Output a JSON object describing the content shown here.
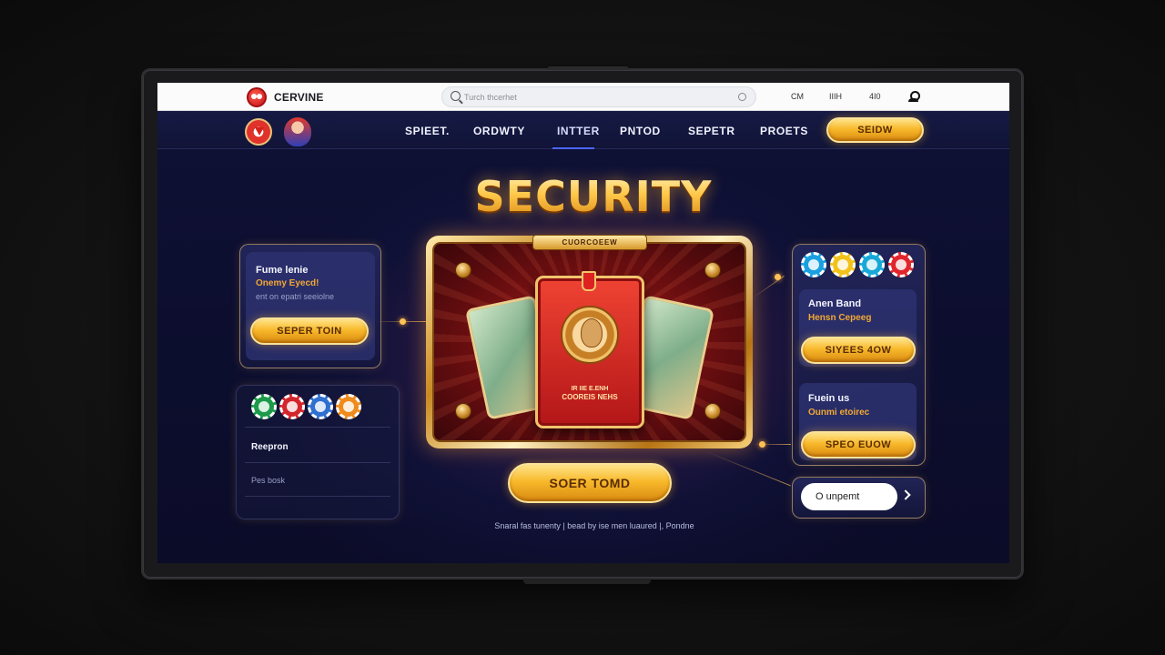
{
  "topbar": {
    "logo_text": "CERVINE",
    "search_placeholder": "Turch thcerhet",
    "items": [
      "CM",
      "IIIH",
      "4I0"
    ]
  },
  "nav": {
    "links": [
      "SPIEET.",
      "ORDWTY",
      "INTTER",
      "PNTOD",
      "SEPETR",
      "PROETS"
    ],
    "active_index": 2,
    "cta_label": "SEIDW"
  },
  "hero": {
    "title": "SECURITY",
    "plaque": "CUORCOEEW",
    "card_text_line1": "IR IIE E.ENH",
    "card_text_line2": "COOREIS NEHS",
    "cta_label": "SOER TOMD",
    "footnote": "Snaral fas tunenty | bead by ise men luaured |, Pondne"
  },
  "left_panel": {
    "title": "Fume lenie",
    "subtitle": "Onemy Eyecd!",
    "meta": "ent on epatri seeiolne",
    "button_label": "SEPER TOIN"
  },
  "left_lower_panel": {
    "chip_colors": [
      "#1c9a4a",
      "#d3262c",
      "#2f6fd0",
      "#ef8b1c"
    ],
    "row1": "Reepron",
    "row2": "Pes bosk"
  },
  "right_panel": {
    "chip_colors": [
      "#1aa0e0",
      "#f2c21a",
      "#18a8d8",
      "#e0262c"
    ],
    "card1_title": "Anen Band",
    "card1_sub": "Hensn Cepeeg",
    "card1_button": "SIYEES 4OW",
    "card2_title": "Fuein us",
    "card2_sub": "Ounmi etoirec",
    "card2_button": "SPEO EUOW"
  },
  "subscribe": {
    "input_value": "O unpemt"
  }
}
